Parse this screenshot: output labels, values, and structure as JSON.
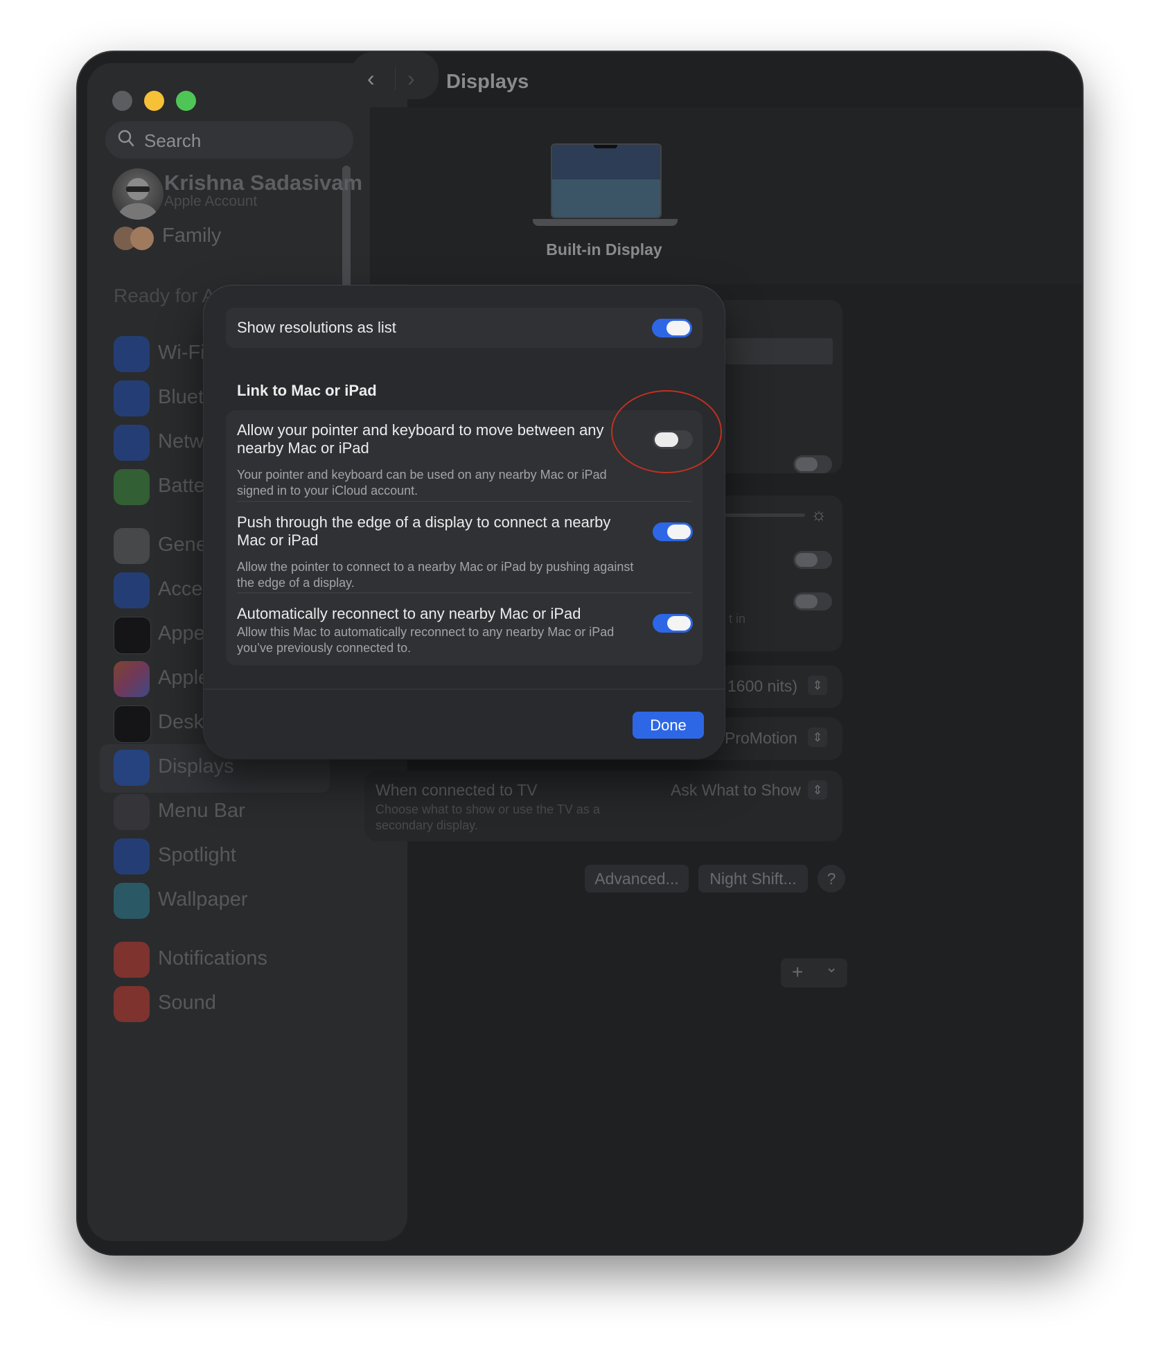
{
  "window": {
    "title": "Displays"
  },
  "sidebar": {
    "search_placeholder": "Search",
    "account": {
      "name": "Krishna Sadasivam",
      "subtitle": "Apple Account"
    },
    "family_label": "Family",
    "apple_intelligence_banner": "Ready for Apple Intelligence",
    "items": [
      {
        "label": "Wi-Fi",
        "icon": "wifi-icon",
        "color": "#1f5bd6"
      },
      {
        "label": "Bluetooth",
        "icon": "bluetooth-icon",
        "color": "#1f5bd6"
      },
      {
        "label": "Network",
        "icon": "globe-icon",
        "color": "#1f5bd6"
      },
      {
        "label": "Battery",
        "icon": "battery-icon",
        "color": "#3e9a3e"
      },
      {
        "label": "General",
        "icon": "gear-icon",
        "color": "#6e6f72"
      },
      {
        "label": "Accessibility",
        "icon": "accessibility-icon",
        "color": "#1f5bd6"
      },
      {
        "label": "Appearance",
        "icon": "appearance-icon",
        "color": "#1a1a1c"
      },
      {
        "label": "Apple Intelligence & Siri",
        "icon": "apple-intelligence-icon",
        "color": "#b0558c"
      },
      {
        "label": "Desktop & Dock",
        "icon": "dock-icon",
        "color": "#1a1a1c"
      },
      {
        "label": "Displays",
        "icon": "sun-icon",
        "color": "#1f5bd6"
      },
      {
        "label": "Menu Bar",
        "icon": "menubar-icon",
        "color": "#2b2c2e"
      },
      {
        "label": "Spotlight",
        "icon": "spotlight-icon",
        "color": "#1f5bd6"
      },
      {
        "label": "Wallpaper",
        "icon": "wallpaper-icon",
        "color": "#2e8fa4"
      },
      {
        "label": "Notifications",
        "icon": "bell-icon",
        "color": "#d94138"
      },
      {
        "label": "Sound",
        "icon": "speaker-icon",
        "color": "#d94138"
      }
    ]
  },
  "main": {
    "display_name": "Built-in Display",
    "background_rows": {
      "brightness_value": "1600 nits)",
      "refresh_value": "ProMotion",
      "tv_title": "When connected to TV",
      "tv_desc": "Choose what to show or use the TV as a secondary display.",
      "tv_value": "Ask What to Show",
      "partial_text": "t in",
      "advanced_button": "Advanced...",
      "night_shift_button": "Night Shift...",
      "help_button": "?",
      "add_button": "+",
      "menu_chevron": "⌄"
    }
  },
  "modal": {
    "show_resolutions_label": "Show resolutions as list",
    "show_resolutions_on": true,
    "section_title": "Link to Mac or iPad",
    "items": [
      {
        "title": "Allow your pointer and keyboard to move between any nearby Mac or iPad",
        "description": "Your pointer and keyboard can be used on any nearby Mac or iPad signed in to your iCloud account.",
        "on": false
      },
      {
        "title": "Push through the edge of a display to connect a nearby Mac or iPad",
        "description": "Allow the pointer to connect to a nearby Mac or iPad by pushing against the edge of a display.",
        "on": true
      },
      {
        "title": "Automatically reconnect to any nearby Mac or iPad",
        "description": "Allow this Mac to automatically reconnect to any nearby Mac or iPad you’ve previously connected to.",
        "on": true
      }
    ],
    "done_label": "Done"
  },
  "colors": {
    "accent": "#2d67e6",
    "annotation": "#c22f21"
  }
}
